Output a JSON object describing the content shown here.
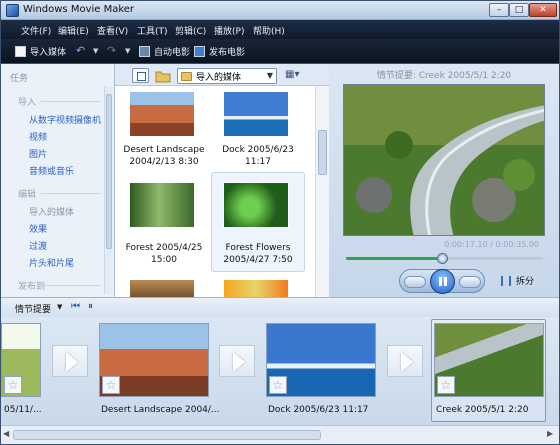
{
  "window": {
    "title": "Windows Movie Maker",
    "min": "–",
    "max": "□",
    "close": "✕"
  },
  "menu": [
    "文件(F)",
    "编辑(E)",
    "查看(V)",
    "工具(T)",
    "剪辑(C)",
    "播放(P)",
    "帮助(H)"
  ],
  "toolbar": {
    "import": "导入媒体",
    "auto_movie": "自动电影",
    "publish": "发布电影"
  },
  "tasks": {
    "title": "任务",
    "import_section": "导入",
    "import_items": [
      "从数字视频摄像机",
      "视频",
      "图片",
      "音频或音乐"
    ],
    "edit_section": "编辑",
    "edit_items": [
      "导入的媒体",
      "效果",
      "过渡",
      "片头和片尾"
    ],
    "publish_section": "发布到"
  },
  "collection": {
    "selected": "导入的媒体"
  },
  "media": [
    {
      "caption": "Desert Landscape 2004/2/13 8:30"
    },
    {
      "caption": "Dock 2005/6/23 11:17"
    },
    {
      "caption": "Forest 2005/4/25 15:00"
    },
    {
      "caption": "Forest Flowers 2005/4/27 7:50"
    }
  ],
  "preview": {
    "title": "情节提要: Creek 2005/5/1 2:20",
    "time": "0:00:17.10 / 0:00:35.00",
    "progress": 0.49,
    "split": "拆分"
  },
  "storyboard": {
    "label": "情节提要",
    "clips": [
      {
        "caption": "05/11/..."
      },
      {
        "caption": "Desert Landscape 2004/..."
      },
      {
        "caption": "Dock 2005/6/23 11:17"
      },
      {
        "caption": "Creek 2005/5/1 2:20"
      }
    ]
  },
  "icons": {
    "star": "☆",
    "dropdown": "▼",
    "undo": "↶",
    "redo": "↷"
  },
  "colors": {
    "link": "#2b62c6",
    "menubar": "#0e1a2c",
    "seek": "#27a84c"
  }
}
